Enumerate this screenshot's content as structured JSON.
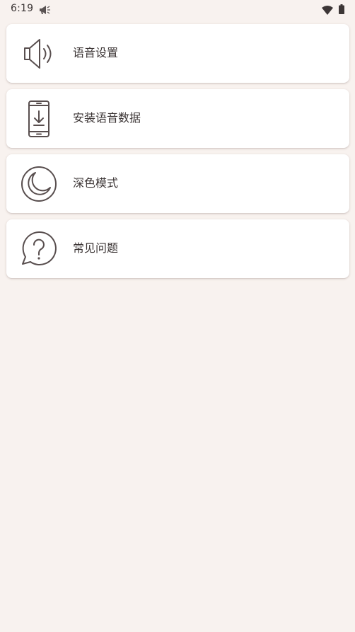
{
  "status_bar": {
    "time": "6:19",
    "notification_icon": "megaphone-icon",
    "wifi_icon": "wifi-icon",
    "battery_icon": "battery-icon"
  },
  "menu": {
    "items": [
      {
        "label": "语音设置",
        "icon": "speaker-icon"
      },
      {
        "label": "安装语音数据",
        "icon": "phone-download-icon"
      },
      {
        "label": "深色模式",
        "icon": "moon-icon"
      },
      {
        "label": "常见问题",
        "icon": "help-bubble-icon"
      }
    ]
  },
  "colors": {
    "background": "#f8f2ef",
    "card": "#ffffff",
    "icon_stroke": "#584e4e",
    "text": "#3a3333"
  }
}
